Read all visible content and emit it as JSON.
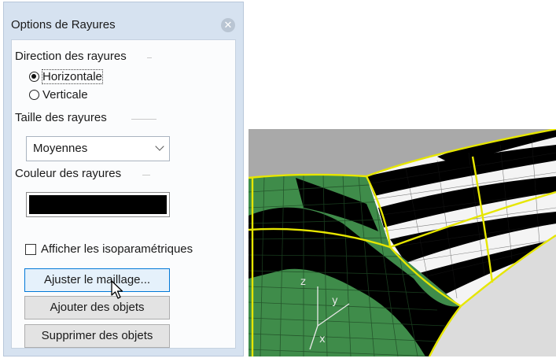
{
  "dialog": {
    "title": "Options de Rayures",
    "close_icon": "close-icon",
    "direction": {
      "label": "Direction des rayures",
      "options": [
        {
          "label": "Horizontale",
          "checked": true
        },
        {
          "label": "Verticale",
          "checked": false
        }
      ]
    },
    "size": {
      "label": "Taille des rayures",
      "selected": "Moyennes"
    },
    "color": {
      "label": "Couleur des rayures",
      "value": "#000000"
    },
    "show_isoparams": {
      "label": "Afficher les isoparamétriques",
      "checked": false
    },
    "buttons": {
      "adjust_mesh": "Ajuster le maillage...",
      "add_objects": "Ajouter des objets",
      "remove_objects": "Supprimer des objets"
    }
  },
  "viewport": {
    "axes": {
      "x": "x",
      "y": "y",
      "z": "z"
    },
    "colors": {
      "surface": "#3f8c4a",
      "stripe": "#000000",
      "edge": "#e6e600",
      "background": "#dcdcdc"
    }
  }
}
